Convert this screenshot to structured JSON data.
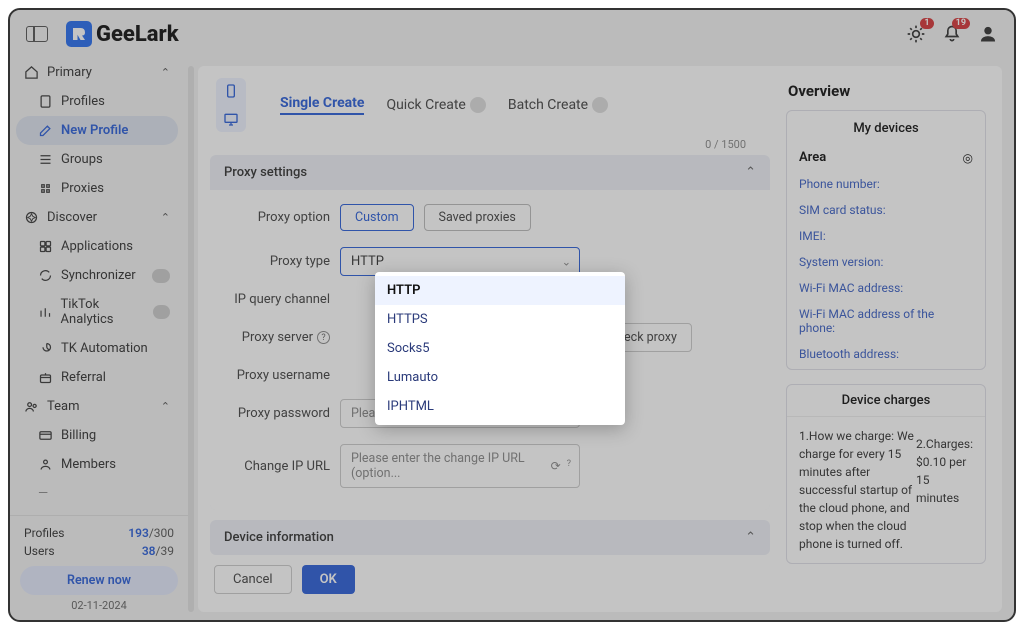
{
  "brand": "GeeLark",
  "topbar": {
    "notif1_badge": "1",
    "notif2_badge": "19"
  },
  "sidebar": {
    "sections": [
      {
        "label": "Primary",
        "items": [
          {
            "label": "Profiles"
          },
          {
            "label": "New Profile"
          },
          {
            "label": "Groups"
          },
          {
            "label": "Proxies"
          }
        ]
      },
      {
        "label": "Discover",
        "items": [
          {
            "label": "Applications"
          },
          {
            "label": "Synchronizer"
          },
          {
            "label": "TikTok Analytics"
          },
          {
            "label": "TK Automation"
          },
          {
            "label": "Referral"
          }
        ]
      },
      {
        "label": "Team",
        "items": [
          {
            "label": "Billing"
          },
          {
            "label": "Members"
          }
        ]
      }
    ],
    "footer": {
      "profiles_label": "Profiles",
      "profiles_cur": "193",
      "profiles_max": "/300",
      "users_label": "Users",
      "users_cur": "38",
      "users_max": "/39",
      "renew": "Renew now",
      "date": "02-11-2024"
    }
  },
  "tabs": {
    "single": "Single Create",
    "quick": "Quick Create",
    "batch": "Batch Create"
  },
  "counter": "0 / 1500",
  "proxy_panel": {
    "title": "Proxy settings",
    "option_label": "Proxy option",
    "option_custom": "Custom",
    "option_saved": "Saved proxies",
    "type_label": "Proxy type",
    "type_value": "HTTP",
    "query_label": "IP query channel",
    "server_label": "Proxy server",
    "check_proxy": "Check proxy",
    "username_label": "Proxy username",
    "password_label": "Proxy password",
    "password_placeholder": "Please enter the proxy password",
    "changeip_label": "Change IP URL",
    "changeip_placeholder": "Please enter the change IP URL (option..."
  },
  "device_panel": {
    "title": "Device information"
  },
  "buttons": {
    "cancel": "Cancel",
    "ok": "OK"
  },
  "overview": {
    "title": "Overview",
    "devices_title": "My devices",
    "rows": [
      {
        "label": "Area"
      },
      {
        "label": "Phone number:"
      },
      {
        "label": "SIM card status:"
      },
      {
        "label": "IMEI:"
      },
      {
        "label": "System version:"
      },
      {
        "label": "Wi-Fi MAC address:"
      },
      {
        "label": "Wi-Fi MAC address of the phone:"
      },
      {
        "label": "Bluetooth address:"
      }
    ],
    "charges_title": "Device charges",
    "charges_body_1": "1.How we charge: We charge for every 15 minutes after successful startup of the cloud phone, and stop when the cloud phone is turned off.",
    "charges_body_2": "2.Charges: $0.10 per 15 minutes"
  },
  "dropdown": [
    "HTTP",
    "HTTPS",
    "Socks5",
    "Lumauto",
    "IPHTML"
  ]
}
